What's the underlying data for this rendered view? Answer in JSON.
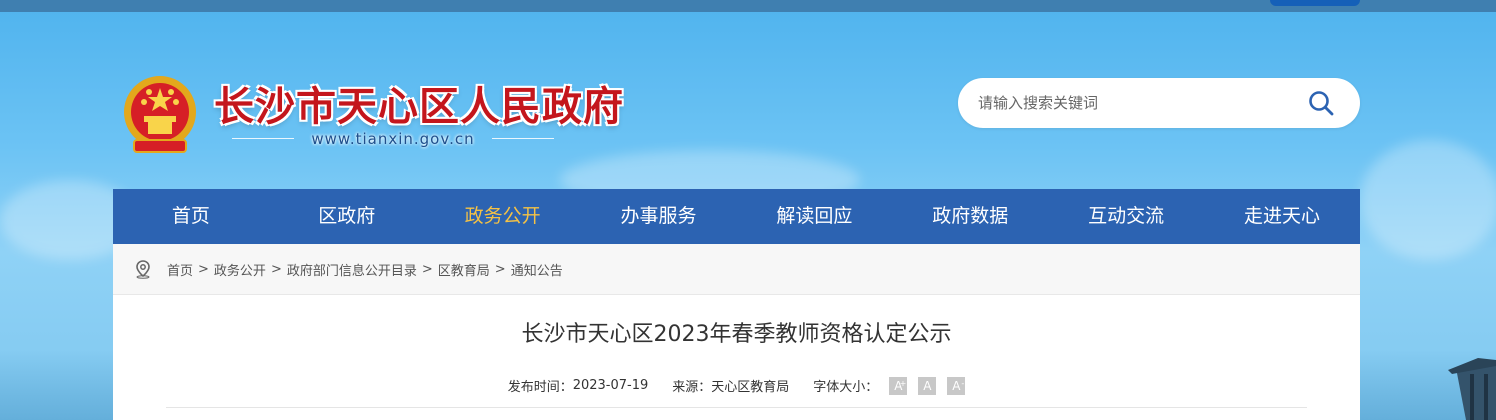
{
  "header": {
    "site_title": "长沙市天心区人民政府",
    "site_url": "www.tianxin.gov.cn",
    "emblem_icon": "national-emblem-icon"
  },
  "search": {
    "placeholder": "请输入搜索关键词",
    "value": "",
    "icon": "search-icon"
  },
  "nav": {
    "items": [
      {
        "label": "首页",
        "active": false
      },
      {
        "label": "区政府",
        "active": false
      },
      {
        "label": "政务公开",
        "active": true
      },
      {
        "label": "办事服务",
        "active": false
      },
      {
        "label": "解读回应",
        "active": false
      },
      {
        "label": "政府数据",
        "active": false
      },
      {
        "label": "互动交流",
        "active": false
      },
      {
        "label": "走进天心",
        "active": false
      }
    ],
    "active_color": "#f5c245",
    "background": "#2c63b2"
  },
  "breadcrumb": {
    "icon": "location-pin-icon",
    "items": [
      "首页",
      "政务公开",
      "政府部门信息公开目录",
      "区教育局",
      "通知公告"
    ],
    "separator": ">"
  },
  "article": {
    "title": "长沙市天心区2023年春季教师资格认定公示",
    "publish_label": "发布时间：",
    "publish_date": "2023-07-19",
    "source_label": "来源：",
    "source": "天心区教育局",
    "font_size_label": "字体大小：",
    "font_buttons": [
      "A",
      "A",
      "A"
    ]
  },
  "colors": {
    "title_red": "#c4161c",
    "sky_blue": "#5bbcf2"
  }
}
